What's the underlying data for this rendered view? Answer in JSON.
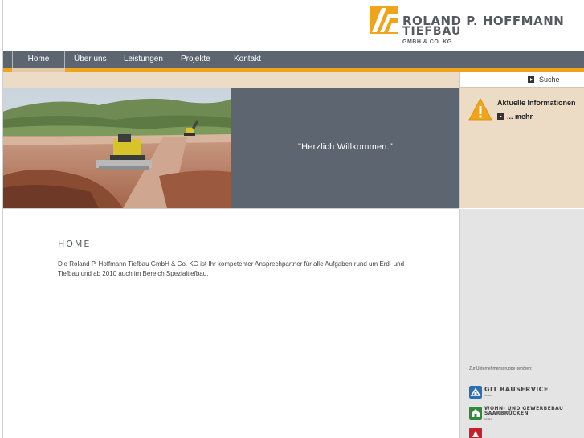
{
  "header": {
    "logo": {
      "line1": "ROLAND P. HOFFMANN",
      "line2": "TIEFBAU",
      "line3": "GMBH & CO. KG"
    }
  },
  "nav": {
    "items": [
      {
        "label": "Home",
        "active": true
      },
      {
        "label": "Über uns"
      },
      {
        "label": "Leistungen"
      },
      {
        "label": "Projekte"
      },
      {
        "label": "Kontakt"
      }
    ]
  },
  "search": {
    "value": "",
    "button_label": "Suche"
  },
  "hero": {
    "photo_icon": "construction-site-photo",
    "welcome_text": "\"Herzlich Willkommen.\""
  },
  "info": {
    "icon": "warning-icon",
    "title": "Aktuelle Informationen",
    "more_label": "... mehr"
  },
  "main": {
    "heading": "HOME",
    "text": "Die Roland P. Hoffmann Tiefbau GmbH & Co. KG ist Ihr kompetenter Ansprechpartner für alle Aufgaben rund um Erd- und Tiefbau und ab 2010 auch im Bereich Spezialtiefbau."
  },
  "sidebar": {
    "group_label": "Zur Unternehmensgruppe gehören:",
    "partners": [
      {
        "name": "GIT BAUSERVICE",
        "sub": "GmbH",
        "color": "#2a6fb4"
      },
      {
        "name_line1": "WOHN- UND GEWERBEBAU",
        "name_line2": "SAARBRÜCKEN",
        "sub": "GmbH",
        "color": "#2e8b3a"
      },
      {
        "color": "#c8202a"
      }
    ]
  },
  "colors": {
    "nav_bg": "#5c6570",
    "accent": "#f0a41c",
    "beige": "#ecdcc6"
  }
}
